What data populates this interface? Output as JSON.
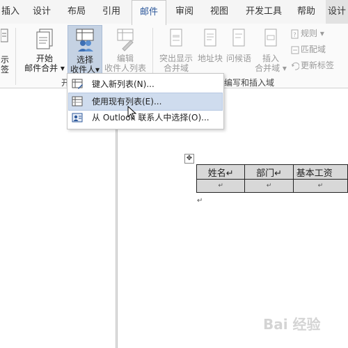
{
  "tabs": [
    "插入",
    "设计",
    "布局",
    "引用",
    "邮件",
    "审阅",
    "视图",
    "开发工具",
    "帮助",
    "设计"
  ],
  "ribbon": {
    "partial_left_labels": [
      "示",
      "签"
    ],
    "start_merge": {
      "line1": "开始",
      "line2": "邮件合并",
      "arrow": "▾"
    },
    "select_recipients": {
      "line1": "选择",
      "line2": "收件人",
      "arrow": "▾"
    },
    "edit_recipients": {
      "line1": "编辑",
      "line2": "收件人列表"
    },
    "highlight_fields": {
      "line1": "突出显示",
      "line2": "合并域"
    },
    "address_block": {
      "line1": "地址块"
    },
    "greeting_line": {
      "line1": "问候语"
    },
    "insert_field": {
      "line1": "插入",
      "line2": "合并域",
      "arrow": "▾"
    },
    "rules": {
      "label": "规则",
      "arrow": "▾"
    },
    "match_fields": {
      "label": "匹配域"
    },
    "update_labels": {
      "label": "更新标签"
    },
    "group_start_partial": "开",
    "group_write_insert": "编写和插入域"
  },
  "menu": {
    "items": [
      {
        "label": "键入新列表(N)...",
        "icon": "new-list-icon"
      },
      {
        "label": "使用现有列表(E)...",
        "icon": "existing-list-icon"
      },
      {
        "label": "从 Outlook 联系人中选择(O)...",
        "icon": "outlook-contacts-icon"
      }
    ]
  },
  "document": {
    "move_handle": "✥",
    "table": {
      "headers": [
        "姓名↵",
        "部门↵",
        "基本工资"
      ],
      "row2": [
        "↵",
        "↵",
        "↵"
      ]
    },
    "pilcrow": "↵"
  },
  "watermark": "Bai 经验",
  "colors": {
    "accent": "#2b579a",
    "menu_hover": "#cfdcee",
    "selected_button": "#c5d2e3"
  }
}
